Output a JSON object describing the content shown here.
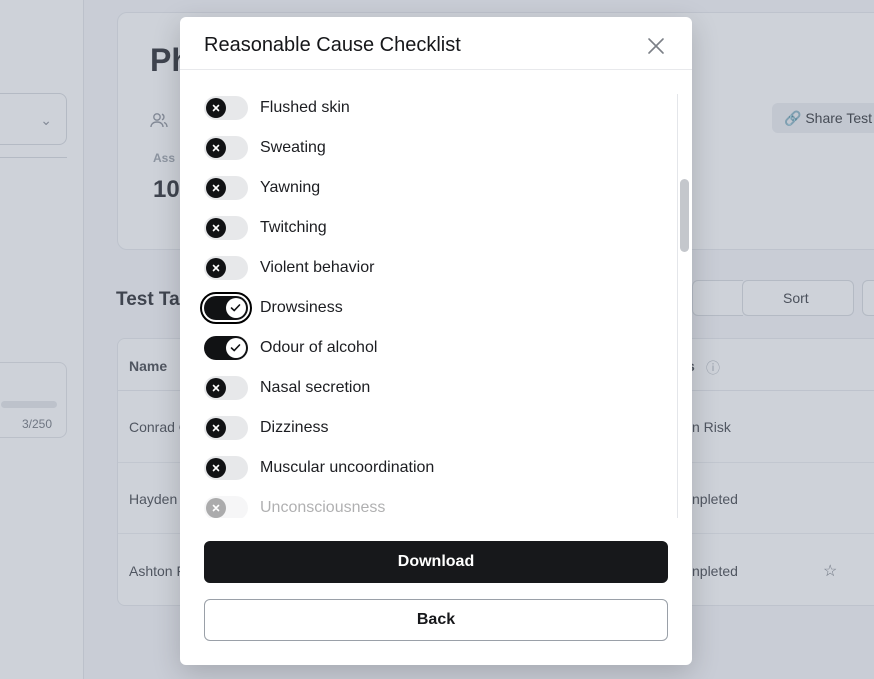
{
  "background": {
    "title": "Ph",
    "assessment_label": "Ass",
    "assessment_value": "10",
    "share_label": "Share Test",
    "section_title": "Test Ta",
    "sort_label": "Sort",
    "quota": "3/250",
    "table": {
      "col_name": "Name",
      "col_status": "s",
      "rows": [
        {
          "name": "Conrad C",
          "status": "n Risk"
        },
        {
          "name": "Hayden",
          "status": "npleted"
        },
        {
          "name": "Ashton F",
          "status": "npleted"
        }
      ]
    }
  },
  "modal": {
    "title": "Reasonable Cause Checklist",
    "items": [
      {
        "label": "Flushed skin",
        "checked": false
      },
      {
        "label": "Sweating",
        "checked": false
      },
      {
        "label": "Yawning",
        "checked": false
      },
      {
        "label": "Twitching",
        "checked": false
      },
      {
        "label": "Violent behavior",
        "checked": false
      },
      {
        "label": "Drowsiness",
        "checked": true
      },
      {
        "label": "Odour of alcohol",
        "checked": true
      },
      {
        "label": "Nasal secretion",
        "checked": false
      },
      {
        "label": "Dizziness",
        "checked": false
      },
      {
        "label": "Muscular uncoordination",
        "checked": false
      },
      {
        "label": "Unconsciousness",
        "checked": false
      }
    ],
    "download_label": "Download",
    "back_label": "Back"
  },
  "icons": {
    "close": "close-icon",
    "toggle_off": "x-icon",
    "toggle_on": "check-icon"
  }
}
